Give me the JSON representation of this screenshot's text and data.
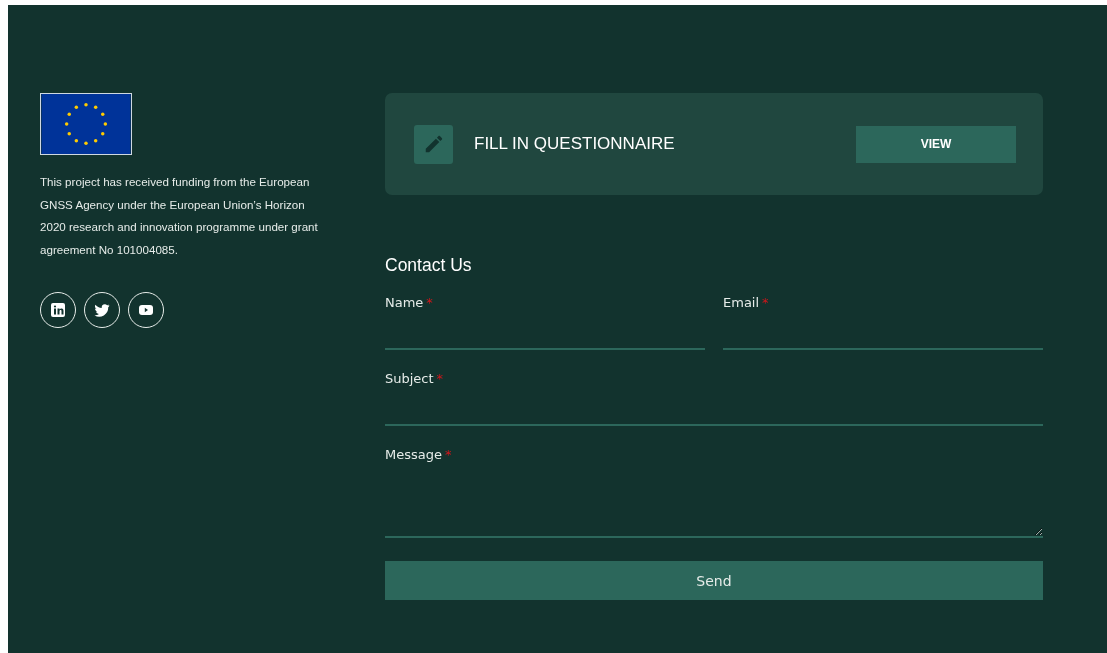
{
  "funding": {
    "text": "This project has received funding from the European GNSS Agency under the European Union’s Horizon 2020 research and innovation programme under grant agreement No 101004085."
  },
  "social_links": [
    {
      "kind": "linkedin"
    },
    {
      "kind": "twitter"
    },
    {
      "kind": "youtube"
    }
  ],
  "questionnaire": {
    "title": "FILL IN QUESTIONNAIRE",
    "button": "VIEW"
  },
  "contact": {
    "heading": "Contact Us",
    "fields": [
      {
        "label": "Name",
        "required_mark": "*",
        "kind": "input",
        "half": true
      },
      {
        "label": "Email",
        "required_mark": "*",
        "kind": "input",
        "half": true
      },
      {
        "label": "Subject",
        "required_mark": "*",
        "kind": "input",
        "half": false
      },
      {
        "label": "Message",
        "required_mark": "*",
        "kind": "textarea",
        "half": false
      }
    ],
    "submit": "Send"
  }
}
